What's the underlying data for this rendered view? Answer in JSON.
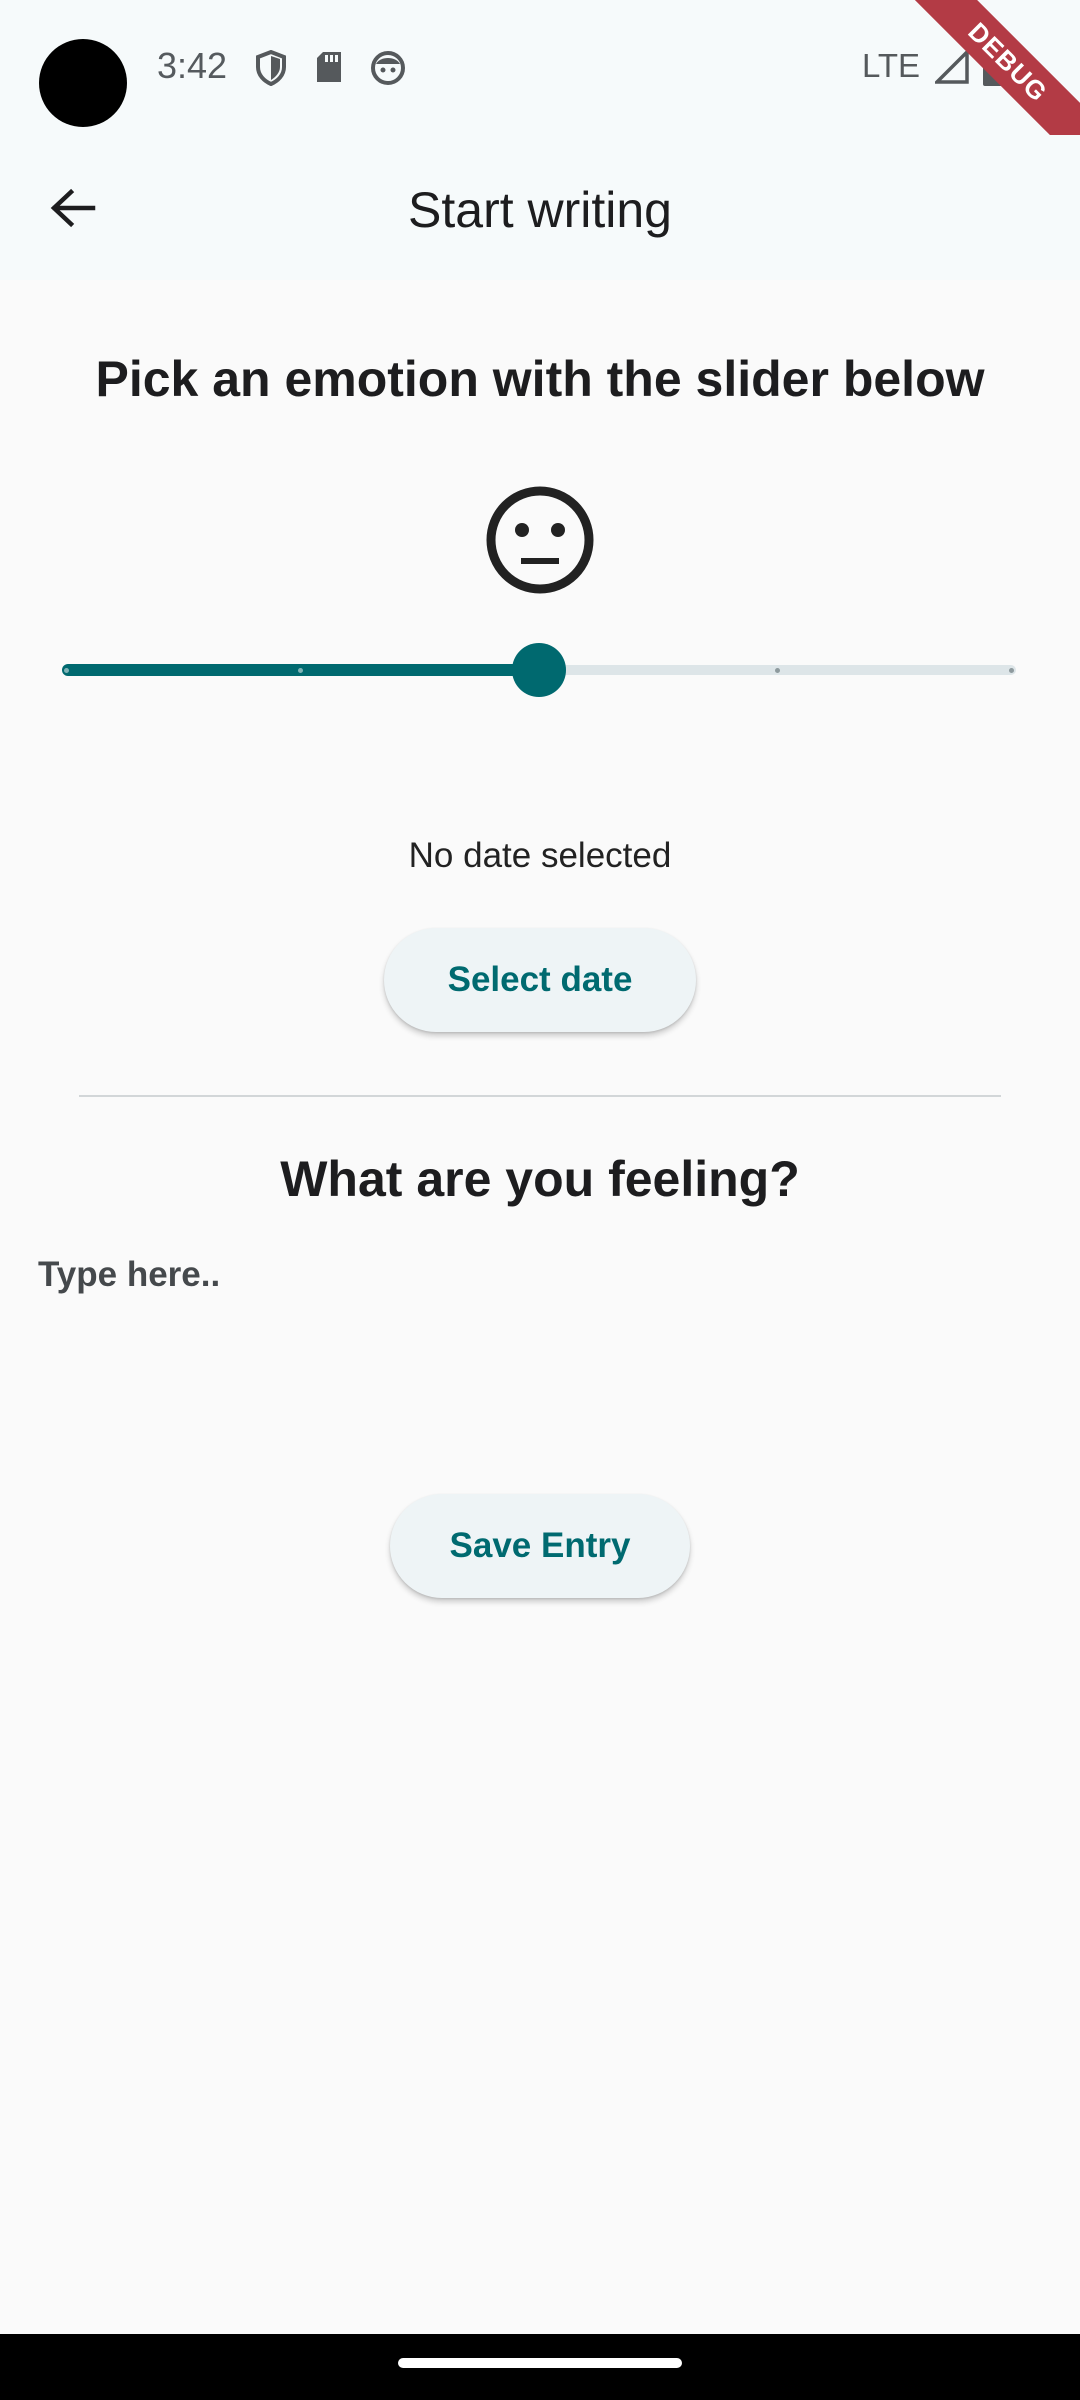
{
  "status_bar": {
    "time": "3:42",
    "network": "LTE",
    "icons": [
      "shield-icon",
      "sd-card-icon",
      "face-icon",
      "signal-icon",
      "battery-icon"
    ]
  },
  "debug_banner": "DEBUG",
  "app_bar": {
    "back_icon": "arrow-back-icon",
    "title": "Start writing"
  },
  "emotion": {
    "heading": "Pick an emotion with the slider below",
    "face_icon": "neutral-face-icon",
    "slider_value": 0.5,
    "slider_divisions": 4
  },
  "date": {
    "status": "No date selected",
    "button_label": "Select date"
  },
  "feeling": {
    "heading": "What are you feeling?",
    "placeholder": "Type here..",
    "value": ""
  },
  "save_label": "Save Entry",
  "colors": {
    "primary": "#00696f",
    "button_bg": "#eef4f6",
    "app_bar_bg": "#f6fafb",
    "page_bg": "#fafafa"
  }
}
